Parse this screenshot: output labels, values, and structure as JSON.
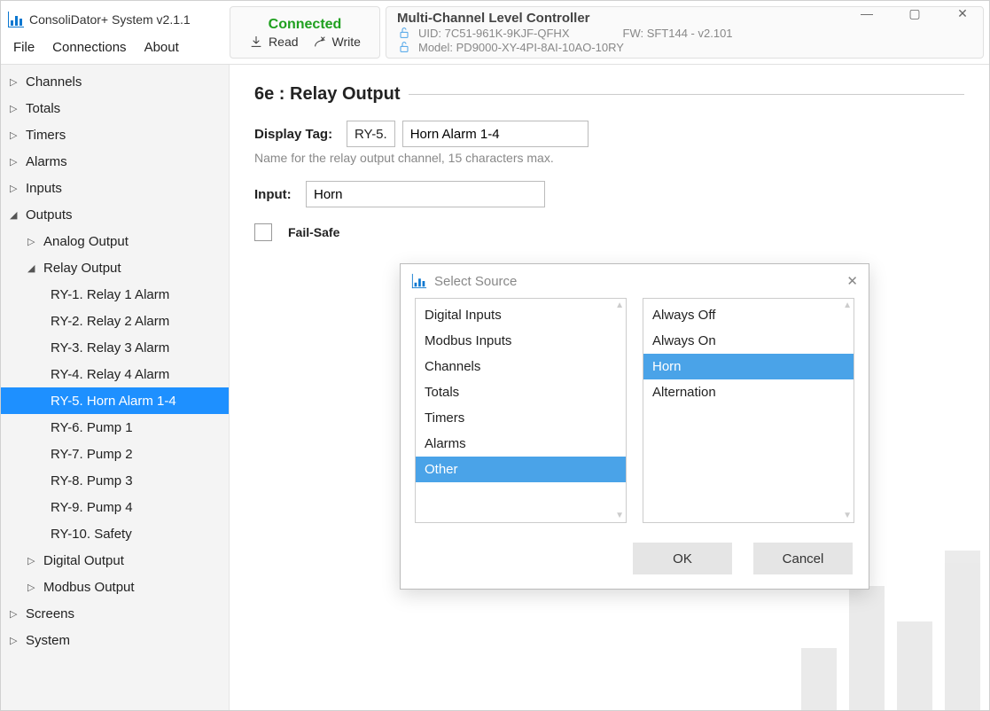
{
  "app": {
    "title": "ConsoliDator+ System v2.1.1"
  },
  "menu": {
    "file": "File",
    "connections": "Connections",
    "about": "About"
  },
  "status": {
    "label": "Connected",
    "read": "Read",
    "write": "Write"
  },
  "device": {
    "title": "Multi-Channel Level Controller",
    "uid": "UID: 7C51-961K-9KJF-QFHX",
    "fw": "FW: SFT144 - v2.101",
    "model": "Model: PD9000-XY-4PI-8AI-10AO-10RY"
  },
  "nav": {
    "channels": "Channels",
    "totals": "Totals",
    "timers": "Timers",
    "alarms": "Alarms",
    "inputs": "Inputs",
    "outputs": "Outputs",
    "analog_output": "Analog Output",
    "relay_output": "Relay Output",
    "relays": [
      "RY-1. Relay 1 Alarm",
      "RY-2. Relay 2 Alarm",
      "RY-3. Relay 3 Alarm",
      "RY-4. Relay 4 Alarm",
      "RY-5. Horn Alarm 1-4",
      "RY-6. Pump 1",
      "RY-7. Pump 2",
      "RY-8. Pump 3",
      "RY-9. Pump 4",
      "RY-10. Safety"
    ],
    "digital_output": "Digital Output",
    "modbus_output": "Modbus Output",
    "screens": "Screens",
    "system": "System"
  },
  "section": {
    "title": "6e : Relay Output",
    "display_tag_label": "Display Tag:",
    "display_tag_prefix": "RY-5.",
    "display_tag_value": "Horn Alarm 1-4",
    "display_tag_help": "Name for the relay output channel, 15 characters max.",
    "input_label": "Input:",
    "input_value": "Horn",
    "failsafe_label": "Fail-Safe"
  },
  "dialog": {
    "title": "Select Source",
    "categories": [
      "Digital Inputs",
      "Modbus Inputs",
      "Channels",
      "Totals",
      "Timers",
      "Alarms",
      "Other"
    ],
    "selected_category": "Other",
    "options": [
      "Always Off",
      "Always On",
      "Horn",
      "Alternation"
    ],
    "selected_option": "Horn",
    "ok": "OK",
    "cancel": "Cancel"
  }
}
